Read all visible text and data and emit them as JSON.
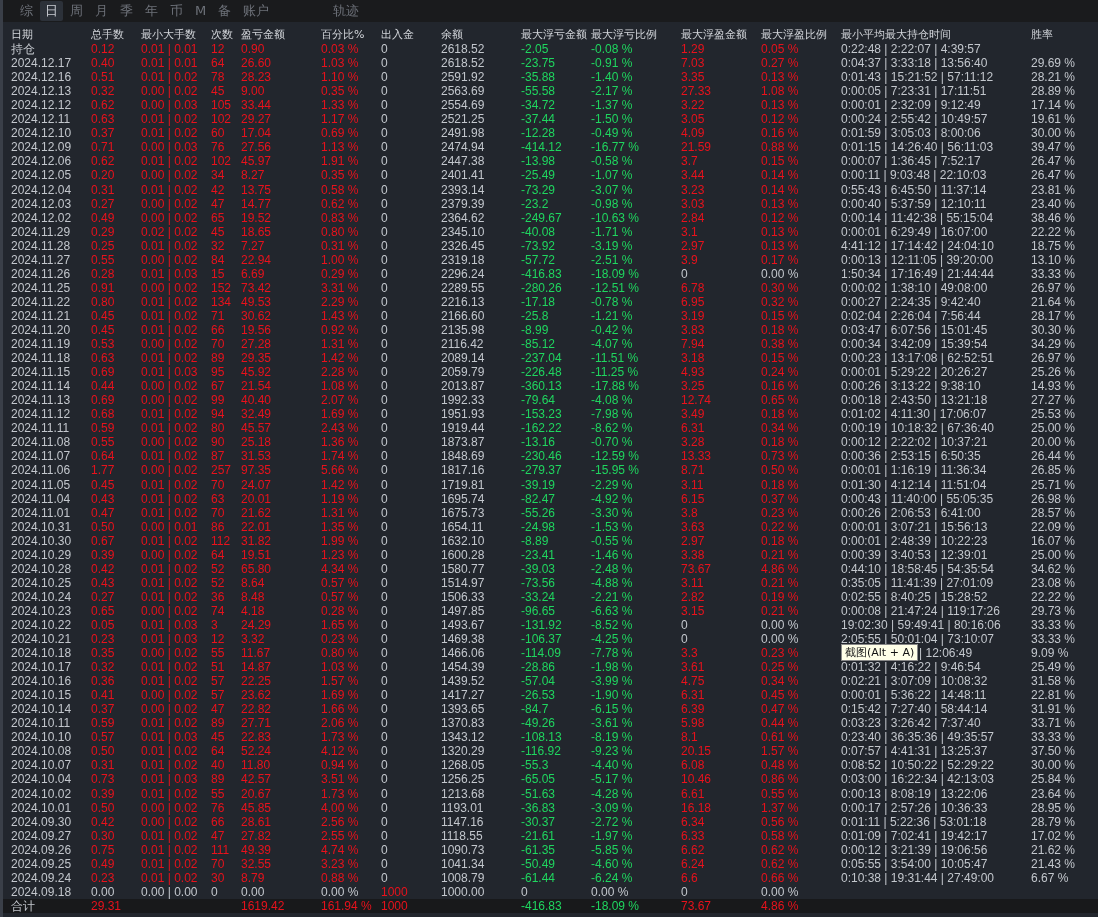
{
  "tabs": [
    {
      "label": "综",
      "selected": false
    },
    {
      "label": "日",
      "selected": true
    },
    {
      "label": "周",
      "selected": false
    },
    {
      "label": "月",
      "selected": false
    },
    {
      "label": "季",
      "selected": false
    },
    {
      "label": "年",
      "selected": false
    },
    {
      "label": "币",
      "selected": false
    },
    {
      "label": "M",
      "selected": false
    },
    {
      "label": "备",
      "selected": false
    },
    {
      "label": "账户",
      "selected": false
    }
  ],
  "trail_tab": {
    "label": "轨迹",
    "selected": false
  },
  "table": {
    "columns": [
      "日期",
      "总手数",
      "最小大手数",
      "次数",
      "盈亏金额",
      "百分比%",
      "出入金",
      "余额",
      "最大浮亏金额",
      "最大浮亏比例",
      "最大浮盈金额",
      "最大浮盈比例",
      "最小平均最大持仓时间",
      "胜率"
    ],
    "rows": [
      {
        "date": "持仓",
        "lots": "0.12",
        "min_max": "0.01 | 0.01",
        "trades": "12",
        "pnl": "0.90",
        "pct": "0.03 %",
        "deposit": "0",
        "balance": "2618.52",
        "max_loss": "-2.05",
        "max_loss_pct": "-0.08 %",
        "max_gain": "1.29",
        "max_gain_pct": "0.05 %",
        "hold_time": "0:22:48 | 2:22:07 | 4:39:57",
        "traded": true,
        "deposited": false,
        "floating_gain": true,
        "floating_loss": true
      },
      {
        "date": "2024.12.17",
        "lots": "0.40",
        "min_max": "0.01 | 0.01",
        "trades": "64",
        "pnl": "26.60",
        "pct": "1.03 %",
        "deposit": "0",
        "balance": "2618.52",
        "max_loss": "-23.75",
        "max_loss_pct": "-0.91 %",
        "max_gain": "7.03",
        "max_gain_pct": "0.27 %",
        "hold_time": "0:04:37 | 3:33:18 | 13:56:40",
        "win_rate": "29.69 %",
        "traded": true,
        "deposited": false,
        "floating_gain": true,
        "floating_loss": true
      },
      {
        "date": "2024.12.16",
        "lots": "0.51",
        "min_max": "0.01 | 0.02",
        "trades": "78",
        "pnl": "28.23",
        "pct": "1.10 %",
        "deposit": "0",
        "balance": "2591.92",
        "max_loss": "-35.88",
        "max_loss_pct": "-1.40 %",
        "max_gain": "3.35",
        "max_gain_pct": "0.13 %",
        "hold_time": "0:01:43 | 15:21:52 | 57:11:12",
        "win_rate": "28.21 %",
        "traded": true,
        "deposited": false,
        "floating_gain": true,
        "floating_loss": true
      },
      {
        "date": "2024.12.13",
        "lots": "0.32",
        "min_max": "0.00 | 0.02",
        "trades": "45",
        "pnl": "9.00",
        "pct": "0.35 %",
        "deposit": "0",
        "balance": "2563.69",
        "max_loss": "-55.58",
        "max_loss_pct": "-2.17 %",
        "max_gain": "27.33",
        "max_gain_pct": "1.08 %",
        "hold_time": "0:00:05 | 7:23:31 | 17:11:51",
        "win_rate": "28.89 %",
        "traded": true,
        "deposited": false,
        "floating_gain": true,
        "floating_loss": true
      },
      {
        "date": "2024.12.12",
        "lots": "0.62",
        "min_max": "0.00 | 0.03",
        "trades": "105",
        "pnl": "33.44",
        "pct": "1.33 %",
        "deposit": "0",
        "balance": "2554.69",
        "max_loss": "-34.72",
        "max_loss_pct": "-1.37 %",
        "max_gain": "3.22",
        "max_gain_pct": "0.13 %",
        "hold_time": "0:00:01 | 2:32:09 | 9:12:49",
        "win_rate": "17.14 %",
        "traded": true,
        "deposited": false,
        "floating_gain": true,
        "floating_loss": true
      },
      {
        "date": "2024.12.11",
        "lots": "0.63",
        "min_max": "0.01 | 0.02",
        "trades": "102",
        "pnl": "29.27",
        "pct": "1.17 %",
        "deposit": "0",
        "balance": "2521.25",
        "max_loss": "-37.44",
        "max_loss_pct": "-1.50 %",
        "max_gain": "3.05",
        "max_gain_pct": "0.12 %",
        "hold_time": "0:00:24 | 2:55:42 | 10:49:57",
        "win_rate": "19.61 %",
        "traded": true,
        "deposited": false,
        "floating_gain": true,
        "floating_loss": true
      },
      {
        "date": "2024.12.10",
        "lots": "0.37",
        "min_max": "0.01 | 0.02",
        "trades": "60",
        "pnl": "17.04",
        "pct": "0.69 %",
        "deposit": "0",
        "balance": "2491.98",
        "max_loss": "-12.28",
        "max_loss_pct": "-0.49 %",
        "max_gain": "4.09",
        "max_gain_pct": "0.16 %",
        "hold_time": "0:01:59 | 3:05:03 | 8:00:06",
        "win_rate": "30.00 %",
        "traded": true,
        "deposited": false,
        "floating_gain": true,
        "floating_loss": true
      },
      {
        "date": "2024.12.09",
        "lots": "0.71",
        "min_max": "0.00 | 0.03",
        "trades": "76",
        "pnl": "27.56",
        "pct": "1.13 %",
        "deposit": "0",
        "balance": "2474.94",
        "max_loss": "-414.12",
        "max_loss_pct": "-16.77 %",
        "max_gain": "21.59",
        "max_gain_pct": "0.88 %",
        "hold_time": "0:01:15 | 14:26:40 | 56:11:03",
        "win_rate": "39.47 %",
        "traded": true,
        "deposited": false,
        "floating_gain": true,
        "floating_loss": true
      },
      {
        "date": "2024.12.06",
        "lots": "0.62",
        "min_max": "0.01 | 0.02",
        "trades": "102",
        "pnl": "45.97",
        "pct": "1.91 %",
        "deposit": "0",
        "balance": "2447.38",
        "max_loss": "-13.98",
        "max_loss_pct": "-0.58 %",
        "max_gain": "3.7",
        "max_gain_pct": "0.15 %",
        "hold_time": "0:00:07 | 1:36:45 | 7:52:17",
        "win_rate": "26.47 %",
        "traded": true,
        "deposited": false,
        "floating_gain": true,
        "floating_loss": true
      },
      {
        "date": "2024.12.05",
        "lots": "0.20",
        "min_max": "0.00 | 0.02",
        "trades": "34",
        "pnl": "8.27",
        "pct": "0.35 %",
        "deposit": "0",
        "balance": "2401.41",
        "max_loss": "-25.49",
        "max_loss_pct": "-1.07 %",
        "max_gain": "3.44",
        "max_gain_pct": "0.14 %",
        "hold_time": "0:00:11 | 9:03:48 | 22:10:03",
        "win_rate": "26.47 %",
        "traded": true,
        "deposited": false,
        "floating_gain": true,
        "floating_loss": true
      },
      {
        "date": "2024.12.04",
        "lots": "0.31",
        "min_max": "0.01 | 0.02",
        "trades": "42",
        "pnl": "13.75",
        "pct": "0.58 %",
        "deposit": "0",
        "balance": "2393.14",
        "max_loss": "-73.29",
        "max_loss_pct": "-3.07 %",
        "max_gain": "3.23",
        "max_gain_pct": "0.14 %",
        "hold_time": "0:55:43 | 6:45:50 | 11:37:14",
        "win_rate": "23.81 %",
        "traded": true,
        "deposited": false,
        "floating_gain": true,
        "floating_loss": true
      },
      {
        "date": "2024.12.03",
        "lots": "0.27",
        "min_max": "0.00 | 0.02",
        "trades": "47",
        "pnl": "14.77",
        "pct": "0.62 %",
        "deposit": "0",
        "balance": "2379.39",
        "max_loss": "-23.2",
        "max_loss_pct": "-0.98 %",
        "max_gain": "3.03",
        "max_gain_pct": "0.13 %",
        "hold_time": "0:00:40 | 5:37:59 | 12:10:11",
        "win_rate": "23.40 %",
        "traded": true,
        "deposited": false,
        "floating_gain": true,
        "floating_loss": true
      },
      {
        "date": "2024.12.02",
        "lots": "0.49",
        "min_max": "0.00 | 0.02",
        "trades": "65",
        "pnl": "19.52",
        "pct": "0.83 %",
        "deposit": "0",
        "balance": "2364.62",
        "max_loss": "-249.67",
        "max_loss_pct": "-10.63 %",
        "max_gain": "2.84",
        "max_gain_pct": "0.12 %",
        "hold_time": "0:00:14 | 11:42:38 | 55:15:04",
        "win_rate": "38.46 %",
        "traded": true,
        "deposited": false,
        "floating_gain": true,
        "floating_loss": true
      },
      {
        "date": "2024.11.29",
        "lots": "0.29",
        "min_max": "0.02 | 0.02",
        "trades": "45",
        "pnl": "18.65",
        "pct": "0.80 %",
        "deposit": "0",
        "balance": "2345.10",
        "max_loss": "-40.08",
        "max_loss_pct": "-1.71 %",
        "max_gain": "3.1",
        "max_gain_pct": "0.13 %",
        "hold_time": "0:00:01 | 6:29:49 | 16:07:00",
        "win_rate": "22.22 %",
        "traded": true,
        "deposited": false,
        "floating_gain": true,
        "floating_loss": true
      },
      {
        "date": "2024.11.28",
        "lots": "0.25",
        "min_max": "0.01 | 0.02",
        "trades": "32",
        "pnl": "7.27",
        "pct": "0.31 %",
        "deposit": "0",
        "balance": "2326.45",
        "max_loss": "-73.92",
        "max_loss_pct": "-3.19 %",
        "max_gain": "2.97",
        "max_gain_pct": "0.13 %",
        "hold_time": "4:41:12 | 17:14:42 | 24:04:10",
        "win_rate": "18.75 %",
        "traded": true,
        "deposited": false,
        "floating_gain": true,
        "floating_loss": true
      },
      {
        "date": "2024.11.27",
        "lots": "0.55",
        "min_max": "0.00 | 0.02",
        "trades": "84",
        "pnl": "22.94",
        "pct": "1.00 %",
        "deposit": "0",
        "balance": "2319.18",
        "max_loss": "-57.72",
        "max_loss_pct": "-2.51 %",
        "max_gain": "3.9",
        "max_gain_pct": "0.17 %",
        "hold_time": "0:00:13 | 12:11:05 | 39:20:00",
        "win_rate": "13.10 %",
        "traded": true,
        "deposited": false,
        "floating_gain": true,
        "floating_loss": true
      },
      {
        "date": "2024.11.26",
        "lots": "0.28",
        "min_max": "0.01 | 0.03",
        "trades": "15",
        "pnl": "6.69",
        "pct": "0.29 %",
        "deposit": "0",
        "balance": "2296.24",
        "max_loss": "-416.83",
        "max_loss_pct": "-18.09 %",
        "max_gain": "0",
        "max_gain_pct": "0.00 %",
        "hold_time": "1:50:34 | 17:16:49 | 21:44:44",
        "win_rate": "33.33 %",
        "traded": true,
        "deposited": false,
        "floating_gain": false,
        "floating_loss": true
      },
      {
        "date": "2024.11.25",
        "lots": "0.91",
        "min_max": "0.00 | 0.02",
        "trades": "152",
        "pnl": "73.42",
        "pct": "3.31 %",
        "deposit": "0",
        "balance": "2289.55",
        "max_loss": "-280.26",
        "max_loss_pct": "-12.51 %",
        "max_gain": "6.78",
        "max_gain_pct": "0.30 %",
        "hold_time": "0:00:02 | 1:38:10 | 49:08:00",
        "win_rate": "26.97 %",
        "traded": true,
        "deposited": false,
        "floating_gain": true,
        "floating_loss": true
      },
      {
        "date": "2024.11.22",
        "lots": "0.80",
        "min_max": "0.01 | 0.02",
        "trades": "134",
        "pnl": "49.53",
        "pct": "2.29 %",
        "deposit": "0",
        "balance": "2216.13",
        "max_loss": "-17.18",
        "max_loss_pct": "-0.78 %",
        "max_gain": "6.95",
        "max_gain_pct": "0.32 %",
        "hold_time": "0:00:27 | 2:24:35 | 9:42:40",
        "win_rate": "21.64 %",
        "traded": true,
        "deposited": false,
        "floating_gain": true,
        "floating_loss": true
      },
      {
        "date": "2024.11.21",
        "lots": "0.45",
        "min_max": "0.01 | 0.02",
        "trades": "71",
        "pnl": "30.62",
        "pct": "1.43 %",
        "deposit": "0",
        "balance": "2166.60",
        "max_loss": "-25.8",
        "max_loss_pct": "-1.21 %",
        "max_gain": "3.19",
        "max_gain_pct": "0.15 %",
        "hold_time": "0:02:04 | 2:26:04 | 7:56:44",
        "win_rate": "28.17 %",
        "traded": true,
        "deposited": false,
        "floating_gain": true,
        "floating_loss": true
      },
      {
        "date": "2024.11.20",
        "lots": "0.45",
        "min_max": "0.01 | 0.02",
        "trades": "66",
        "pnl": "19.56",
        "pct": "0.92 %",
        "deposit": "0",
        "balance": "2135.98",
        "max_loss": "-8.99",
        "max_loss_pct": "-0.42 %",
        "max_gain": "3.83",
        "max_gain_pct": "0.18 %",
        "hold_time": "0:03:47 | 6:07:56 | 15:01:45",
        "win_rate": "30.30 %",
        "traded": true,
        "deposited": false,
        "floating_gain": true,
        "floating_loss": true
      },
      {
        "date": "2024.11.19",
        "lots": "0.53",
        "min_max": "0.00 | 0.02",
        "trades": "70",
        "pnl": "27.28",
        "pct": "1.31 %",
        "deposit": "0",
        "balance": "2116.42",
        "max_loss": "-85.12",
        "max_loss_pct": "-4.07 %",
        "max_gain": "7.94",
        "max_gain_pct": "0.38 %",
        "hold_time": "0:00:34 | 3:42:09 | 15:39:54",
        "win_rate": "34.29 %",
        "traded": true,
        "deposited": false,
        "floating_gain": true,
        "floating_loss": true
      },
      {
        "date": "2024.11.18",
        "lots": "0.63",
        "min_max": "0.01 | 0.02",
        "trades": "89",
        "pnl": "29.35",
        "pct": "1.42 %",
        "deposit": "0",
        "balance": "2089.14",
        "max_loss": "-237.04",
        "max_loss_pct": "-11.51 %",
        "max_gain": "3.18",
        "max_gain_pct": "0.15 %",
        "hold_time": "0:00:23 | 13:17:08 | 62:52:51",
        "win_rate": "26.97 %",
        "traded": true,
        "deposited": false,
        "floating_gain": true,
        "floating_loss": true
      },
      {
        "date": "2024.11.15",
        "lots": "0.69",
        "min_max": "0.01 | 0.03",
        "trades": "95",
        "pnl": "45.92",
        "pct": "2.28 %",
        "deposit": "0",
        "balance": "2059.79",
        "max_loss": "-226.48",
        "max_loss_pct": "-11.25 %",
        "max_gain": "4.93",
        "max_gain_pct": "0.24 %",
        "hold_time": "0:00:01 | 5:29:22 | 20:26:27",
        "win_rate": "25.26 %",
        "traded": true,
        "deposited": false,
        "floating_gain": true,
        "floating_loss": true
      },
      {
        "date": "2024.11.14",
        "lots": "0.44",
        "min_max": "0.00 | 0.02",
        "trades": "67",
        "pnl": "21.54",
        "pct": "1.08 %",
        "deposit": "0",
        "balance": "2013.87",
        "max_loss": "-360.13",
        "max_loss_pct": "-17.88 %",
        "max_gain": "3.25",
        "max_gain_pct": "0.16 %",
        "hold_time": "0:00:26 | 3:13:22 | 9:38:10",
        "win_rate": "14.93 %",
        "traded": true,
        "deposited": false,
        "floating_gain": true,
        "floating_loss": true
      },
      {
        "date": "2024.11.13",
        "lots": "0.69",
        "min_max": "0.00 | 0.02",
        "trades": "99",
        "pnl": "40.40",
        "pct": "2.07 %",
        "deposit": "0",
        "balance": "1992.33",
        "max_loss": "-79.64",
        "max_loss_pct": "-4.08 %",
        "max_gain": "12.74",
        "max_gain_pct": "0.65 %",
        "hold_time": "0:00:18 | 2:43:50 | 13:21:18",
        "win_rate": "27.27 %",
        "traded": true,
        "deposited": false,
        "floating_gain": true,
        "floating_loss": true
      },
      {
        "date": "2024.11.12",
        "lots": "0.68",
        "min_max": "0.01 | 0.02",
        "trades": "94",
        "pnl": "32.49",
        "pct": "1.69 %",
        "deposit": "0",
        "balance": "1951.93",
        "max_loss": "-153.23",
        "max_loss_pct": "-7.98 %",
        "max_gain": "3.49",
        "max_gain_pct": "0.18 %",
        "hold_time": "0:01:02 | 4:11:30 | 17:06:07",
        "win_rate": "25.53 %",
        "traded": true,
        "deposited": false,
        "floating_gain": true,
        "floating_loss": true
      },
      {
        "date": "2024.11.11",
        "lots": "0.59",
        "min_max": "0.01 | 0.02",
        "trades": "80",
        "pnl": "45.57",
        "pct": "2.43 %",
        "deposit": "0",
        "balance": "1919.44",
        "max_loss": "-162.22",
        "max_loss_pct": "-8.62 %",
        "max_gain": "6.31",
        "max_gain_pct": "0.34 %",
        "hold_time": "0:00:19 | 10:18:32 | 67:36:40",
        "win_rate": "25.00 %",
        "traded": true,
        "deposited": false,
        "floating_gain": true,
        "floating_loss": true
      },
      {
        "date": "2024.11.08",
        "lots": "0.55",
        "min_max": "0.00 | 0.02",
        "trades": "90",
        "pnl": "25.18",
        "pct": "1.36 %",
        "deposit": "0",
        "balance": "1873.87",
        "max_loss": "-13.16",
        "max_loss_pct": "-0.70 %",
        "max_gain": "3.28",
        "max_gain_pct": "0.18 %",
        "hold_time": "0:00:12 | 2:22:02 | 10:37:21",
        "win_rate": "20.00 %",
        "traded": true,
        "deposited": false,
        "floating_gain": true,
        "floating_loss": true
      },
      {
        "date": "2024.11.07",
        "lots": "0.64",
        "min_max": "0.01 | 0.02",
        "trades": "87",
        "pnl": "31.53",
        "pct": "1.74 %",
        "deposit": "0",
        "balance": "1848.69",
        "max_loss": "-230.46",
        "max_loss_pct": "-12.59 %",
        "max_gain": "13.33",
        "max_gain_pct": "0.73 %",
        "hold_time": "0:00:36 | 2:53:15 | 6:50:35",
        "win_rate": "26.44 %",
        "traded": true,
        "deposited": false,
        "floating_gain": true,
        "floating_loss": true
      },
      {
        "date": "2024.11.06",
        "lots": "1.77",
        "min_max": "0.00 | 0.02",
        "trades": "257",
        "pnl": "97.35",
        "pct": "5.66 %",
        "deposit": "0",
        "balance": "1817.16",
        "max_loss": "-279.37",
        "max_loss_pct": "-15.95 %",
        "max_gain": "8.71",
        "max_gain_pct": "0.50 %",
        "hold_time": "0:00:01 | 1:16:19 | 11:36:34",
        "win_rate": "26.85 %",
        "traded": true,
        "deposited": false,
        "floating_gain": true,
        "floating_loss": true
      },
      {
        "date": "2024.11.05",
        "lots": "0.45",
        "min_max": "0.01 | 0.02",
        "trades": "70",
        "pnl": "24.07",
        "pct": "1.42 %",
        "deposit": "0",
        "balance": "1719.81",
        "max_loss": "-39.19",
        "max_loss_pct": "-2.29 %",
        "max_gain": "3.11",
        "max_gain_pct": "0.18 %",
        "hold_time": "0:01:30 | 4:12:14 | 11:51:04",
        "win_rate": "25.71 %",
        "traded": true,
        "deposited": false,
        "floating_gain": true,
        "floating_loss": true
      },
      {
        "date": "2024.11.04",
        "lots": "0.43",
        "min_max": "0.01 | 0.02",
        "trades": "63",
        "pnl": "20.01",
        "pct": "1.19 %",
        "deposit": "0",
        "balance": "1695.74",
        "max_loss": "-82.47",
        "max_loss_pct": "-4.92 %",
        "max_gain": "6.15",
        "max_gain_pct": "0.37 %",
        "hold_time": "0:00:43 | 11:40:00 | 55:05:35",
        "win_rate": "26.98 %",
        "traded": true,
        "deposited": false,
        "floating_gain": true,
        "floating_loss": true
      },
      {
        "date": "2024.11.01",
        "lots": "0.47",
        "min_max": "0.01 | 0.02",
        "trades": "70",
        "pnl": "21.62",
        "pct": "1.31 %",
        "deposit": "0",
        "balance": "1675.73",
        "max_loss": "-55.26",
        "max_loss_pct": "-3.30 %",
        "max_gain": "3.8",
        "max_gain_pct": "0.23 %",
        "hold_time": "0:00:26 | 2:06:53 | 6:41:00",
        "win_rate": "28.57 %",
        "traded": true,
        "deposited": false,
        "floating_gain": true,
        "floating_loss": true
      },
      {
        "date": "2024.10.31",
        "lots": "0.50",
        "min_max": "0.00 | 0.01",
        "trades": "86",
        "pnl": "22.01",
        "pct": "1.35 %",
        "deposit": "0",
        "balance": "1654.11",
        "max_loss": "-24.98",
        "max_loss_pct": "-1.53 %",
        "max_gain": "3.63",
        "max_gain_pct": "0.22 %",
        "hold_time": "0:00:01 | 3:07:21 | 15:56:13",
        "win_rate": "22.09 %",
        "traded": true,
        "deposited": false,
        "floating_gain": true,
        "floating_loss": true
      },
      {
        "date": "2024.10.30",
        "lots": "0.67",
        "min_max": "0.01 | 0.02",
        "trades": "112",
        "pnl": "31.82",
        "pct": "1.99 %",
        "deposit": "0",
        "balance": "1632.10",
        "max_loss": "-8.89",
        "max_loss_pct": "-0.55 %",
        "max_gain": "2.97",
        "max_gain_pct": "0.18 %",
        "hold_time": "0:00:01 | 2:48:39 | 10:22:23",
        "win_rate": "16.07 %",
        "traded": true,
        "deposited": false,
        "floating_gain": true,
        "floating_loss": true
      },
      {
        "date": "2024.10.29",
        "lots": "0.39",
        "min_max": "0.00 | 0.02",
        "trades": "64",
        "pnl": "19.51",
        "pct": "1.23 %",
        "deposit": "0",
        "balance": "1600.28",
        "max_loss": "-23.41",
        "max_loss_pct": "-1.46 %",
        "max_gain": "3.38",
        "max_gain_pct": "0.21 %",
        "hold_time": "0:00:39 | 3:40:53 | 12:39:01",
        "win_rate": "25.00 %",
        "traded": true,
        "deposited": false,
        "floating_gain": true,
        "floating_loss": true
      },
      {
        "date": "2024.10.28",
        "lots": "0.42",
        "min_max": "0.01 | 0.02",
        "trades": "52",
        "pnl": "65.80",
        "pct": "4.34 %",
        "deposit": "0",
        "balance": "1580.77",
        "max_loss": "-39.03",
        "max_loss_pct": "-2.48 %",
        "max_gain": "73.67",
        "max_gain_pct": "4.86 %",
        "hold_time": "0:44:10 | 18:58:45 | 54:35:54",
        "win_rate": "34.62 %",
        "traded": true,
        "deposited": false,
        "floating_gain": true,
        "floating_loss": true
      },
      {
        "date": "2024.10.25",
        "lots": "0.43",
        "min_max": "0.01 | 0.02",
        "trades": "52",
        "pnl": "8.64",
        "pct": "0.57 %",
        "deposit": "0",
        "balance": "1514.97",
        "max_loss": "-73.56",
        "max_loss_pct": "-4.88 %",
        "max_gain": "3.11",
        "max_gain_pct": "0.21 %",
        "hold_time": "0:35:05 | 11:41:39 | 27:01:09",
        "win_rate": "23.08 %",
        "traded": true,
        "deposited": false,
        "floating_gain": true,
        "floating_loss": true
      },
      {
        "date": "2024.10.24",
        "lots": "0.27",
        "min_max": "0.01 | 0.02",
        "trades": "36",
        "pnl": "8.48",
        "pct": "0.57 %",
        "deposit": "0",
        "balance": "1506.33",
        "max_loss": "-33.24",
        "max_loss_pct": "-2.21 %",
        "max_gain": "2.82",
        "max_gain_pct": "0.19 %",
        "hold_time": "0:02:55 | 8:40:25 | 15:28:52",
        "win_rate": "22.22 %",
        "traded": true,
        "deposited": false,
        "floating_gain": true,
        "floating_loss": true
      },
      {
        "date": "2024.10.23",
        "lots": "0.65",
        "min_max": "0.00 | 0.02",
        "trades": "74",
        "pnl": "4.18",
        "pct": "0.28 %",
        "deposit": "0",
        "balance": "1497.85",
        "max_loss": "-96.65",
        "max_loss_pct": "-6.63 %",
        "max_gain": "3.15",
        "max_gain_pct": "0.21 %",
        "hold_time": "0:00:08 | 21:47:24 | 119:17:26",
        "win_rate": "29.73 %",
        "traded": true,
        "deposited": false,
        "floating_gain": true,
        "floating_loss": true
      },
      {
        "date": "2024.10.22",
        "lots": "0.05",
        "min_max": "0.01 | 0.03",
        "trades": "3",
        "pnl": "24.29",
        "pct": "1.65 %",
        "deposit": "0",
        "balance": "1493.67",
        "max_loss": "-131.92",
        "max_loss_pct": "-8.52 %",
        "max_gain": "0",
        "max_gain_pct": "0.00 %",
        "hold_time": "19:02:30 | 59:49:41 | 80:16:06",
        "win_rate": "33.33 %",
        "traded": true,
        "deposited": false,
        "floating_gain": false,
        "floating_loss": true
      },
      {
        "date": "2024.10.21",
        "lots": "0.23",
        "min_max": "0.01 | 0.03",
        "trades": "12",
        "pnl": "3.32",
        "pct": "0.23 %",
        "deposit": "0",
        "balance": "1469.38",
        "max_loss": "-106.37",
        "max_loss_pct": "-4.25 %",
        "max_gain": "0",
        "max_gain_pct": "0.00 %",
        "hold_time": "2:05:55 | 50:01:04 | 73:10:07",
        "win_rate": "33.33 %",
        "traded": true,
        "deposited": false,
        "floating_gain": false,
        "floating_loss": true
      },
      {
        "date": "2024.10.18",
        "lots": "0.35",
        "min_max": "0.00 | 0.02",
        "trades": "55",
        "pnl": "11.67",
        "pct": "0.80 %",
        "deposit": "0",
        "balance": "1466.06",
        "max_loss": "-114.09",
        "max_loss_pct": "-7.78 %",
        "max_gain": "3.3",
        "max_gain_pct": "0.23 %",
        "tooltip": "截图(Alt + A)",
        "hold_time": "| 12:06:49",
        "win_rate": "9.09 %",
        "traded": true,
        "deposited": false,
        "floating_gain": true,
        "floating_loss": true
      },
      {
        "date": "2024.10.17",
        "lots": "0.32",
        "min_max": "0.01 | 0.02",
        "trades": "51",
        "pnl": "14.87",
        "pct": "1.03 %",
        "deposit": "0",
        "balance": "1454.39",
        "max_loss": "-28.86",
        "max_loss_pct": "-1.98 %",
        "max_gain": "3.61",
        "max_gain_pct": "0.25 %",
        "hold_time": "0:01:32 | 4:16:22 | 9:46:54",
        "win_rate": "25.49 %",
        "traded": true,
        "deposited": false,
        "floating_gain": true,
        "floating_loss": true
      },
      {
        "date": "2024.10.16",
        "lots": "0.36",
        "min_max": "0.01 | 0.02",
        "trades": "57",
        "pnl": "22.25",
        "pct": "1.57 %",
        "deposit": "0",
        "balance": "1439.52",
        "max_loss": "-57.04",
        "max_loss_pct": "-3.99 %",
        "max_gain": "4.75",
        "max_gain_pct": "0.34 %",
        "hold_time": "0:02:21 | 3:07:09 | 10:08:32",
        "win_rate": "31.58 %",
        "traded": true,
        "deposited": false,
        "floating_gain": true,
        "floating_loss": true
      },
      {
        "date": "2024.10.15",
        "lots": "0.41",
        "min_max": "0.00 | 0.02",
        "trades": "57",
        "pnl": "23.62",
        "pct": "1.69 %",
        "deposit": "0",
        "balance": "1417.27",
        "max_loss": "-26.53",
        "max_loss_pct": "-1.90 %",
        "max_gain": "6.31",
        "max_gain_pct": "0.45 %",
        "hold_time": "0:00:01 | 5:36:22 | 14:48:11",
        "win_rate": "22.81 %",
        "traded": true,
        "deposited": false,
        "floating_gain": true,
        "floating_loss": true
      },
      {
        "date": "2024.10.14",
        "lots": "0.37",
        "min_max": "0.00 | 0.02",
        "trades": "47",
        "pnl": "22.82",
        "pct": "1.66 %",
        "deposit": "0",
        "balance": "1393.65",
        "max_loss": "-84.7",
        "max_loss_pct": "-6.15 %",
        "max_gain": "6.39",
        "max_gain_pct": "0.47 %",
        "hold_time": "0:15:42 | 7:27:40 | 58:44:14",
        "win_rate": "31.91 %",
        "traded": true,
        "deposited": false,
        "floating_gain": true,
        "floating_loss": true
      },
      {
        "date": "2024.10.11",
        "lots": "0.59",
        "min_max": "0.01 | 0.02",
        "trades": "89",
        "pnl": "27.71",
        "pct": "2.06 %",
        "deposit": "0",
        "balance": "1370.83",
        "max_loss": "-49.26",
        "max_loss_pct": "-3.61 %",
        "max_gain": "5.98",
        "max_gain_pct": "0.44 %",
        "hold_time": "0:03:23 | 3:26:42 | 7:37:40",
        "win_rate": "33.71 %",
        "traded": true,
        "deposited": false,
        "floating_gain": true,
        "floating_loss": true
      },
      {
        "date": "2024.10.10",
        "lots": "0.57",
        "min_max": "0.01 | 0.03",
        "trades": "45",
        "pnl": "22.83",
        "pct": "1.73 %",
        "deposit": "0",
        "balance": "1343.12",
        "max_loss": "-108.13",
        "max_loss_pct": "-8.19 %",
        "max_gain": "8.1",
        "max_gain_pct": "0.61 %",
        "hold_time": "0:23:40 | 36:35:36 | 49:35:57",
        "win_rate": "33.33 %",
        "traded": true,
        "deposited": false,
        "floating_gain": true,
        "floating_loss": true
      },
      {
        "date": "2024.10.08",
        "lots": "0.50",
        "min_max": "0.01 | 0.02",
        "trades": "64",
        "pnl": "52.24",
        "pct": "4.12 %",
        "deposit": "0",
        "balance": "1320.29",
        "max_loss": "-116.92",
        "max_loss_pct": "-9.23 %",
        "max_gain": "20.15",
        "max_gain_pct": "1.57 %",
        "hold_time": "0:07:57 | 4:41:31 | 13:25:37",
        "win_rate": "37.50 %",
        "traded": true,
        "deposited": false,
        "floating_gain": true,
        "floating_loss": true
      },
      {
        "date": "2024.10.07",
        "lots": "0.31",
        "min_max": "0.01 | 0.02",
        "trades": "40",
        "pnl": "11.80",
        "pct": "0.94 %",
        "deposit": "0",
        "balance": "1268.05",
        "max_loss": "-55.3",
        "max_loss_pct": "-4.40 %",
        "max_gain": "6.08",
        "max_gain_pct": "0.48 %",
        "hold_time": "0:08:52 | 10:50:22 | 52:29:22",
        "win_rate": "30.00 %",
        "traded": true,
        "deposited": false,
        "floating_gain": true,
        "floating_loss": true
      },
      {
        "date": "2024.10.04",
        "lots": "0.73",
        "min_max": "0.01 | 0.03",
        "trades": "89",
        "pnl": "42.57",
        "pct": "3.51 %",
        "deposit": "0",
        "balance": "1256.25",
        "max_loss": "-65.05",
        "max_loss_pct": "-5.17 %",
        "max_gain": "10.46",
        "max_gain_pct": "0.86 %",
        "hold_time": "0:03:00 | 16:22:34 | 42:13:03",
        "win_rate": "25.84 %",
        "traded": true,
        "deposited": false,
        "floating_gain": true,
        "floating_loss": true
      },
      {
        "date": "2024.10.02",
        "lots": "0.39",
        "min_max": "0.01 | 0.02",
        "trades": "55",
        "pnl": "20.67",
        "pct": "1.73 %",
        "deposit": "0",
        "balance": "1213.68",
        "max_loss": "-51.63",
        "max_loss_pct": "-4.28 %",
        "max_gain": "6.61",
        "max_gain_pct": "0.55 %",
        "hold_time": "0:00:13 | 8:08:19 | 13:22:06",
        "win_rate": "23.64 %",
        "traded": true,
        "deposited": false,
        "floating_gain": true,
        "floating_loss": true
      },
      {
        "date": "2024.10.01",
        "lots": "0.50",
        "min_max": "0.00 | 0.02",
        "trades": "76",
        "pnl": "45.85",
        "pct": "4.00 %",
        "deposit": "0",
        "balance": "1193.01",
        "max_loss": "-36.83",
        "max_loss_pct": "-3.09 %",
        "max_gain": "16.18",
        "max_gain_pct": "1.37 %",
        "hold_time": "0:00:17 | 2:57:26 | 10:36:33",
        "win_rate": "28.95 %",
        "traded": true,
        "deposited": false,
        "floating_gain": true,
        "floating_loss": true
      },
      {
        "date": "2024.09.30",
        "lots": "0.42",
        "min_max": "0.00 | 0.02",
        "trades": "66",
        "pnl": "28.61",
        "pct": "2.56 %",
        "deposit": "0",
        "balance": "1147.16",
        "max_loss": "-30.37",
        "max_loss_pct": "-2.72 %",
        "max_gain": "6.34",
        "max_gain_pct": "0.56 %",
        "hold_time": "0:01:11 | 5:22:36 | 53:01:18",
        "win_rate": "28.79 %",
        "traded": true,
        "deposited": false,
        "floating_gain": true,
        "floating_loss": true
      },
      {
        "date": "2024.09.27",
        "lots": "0.30",
        "min_max": "0.01 | 0.02",
        "trades": "47",
        "pnl": "27.82",
        "pct": "2.55 %",
        "deposit": "0",
        "balance": "1118.55",
        "max_loss": "-21.61",
        "max_loss_pct": "-1.97 %",
        "max_gain": "6.33",
        "max_gain_pct": "0.58 %",
        "hold_time": "0:01:09 | 7:02:41 | 19:42:17",
        "win_rate": "17.02 %",
        "traded": true,
        "deposited": false,
        "floating_gain": true,
        "floating_loss": true
      },
      {
        "date": "2024.09.26",
        "lots": "0.75",
        "min_max": "0.01 | 0.02",
        "trades": "111",
        "pnl": "49.39",
        "pct": "4.74 %",
        "deposit": "0",
        "balance": "1090.73",
        "max_loss": "-61.35",
        "max_loss_pct": "-5.85 %",
        "max_gain": "6.62",
        "max_gain_pct": "0.62 %",
        "hold_time": "0:00:12 | 3:21:39 | 19:06:56",
        "win_rate": "21.62 %",
        "traded": true,
        "deposited": false,
        "floating_gain": true,
        "floating_loss": true
      },
      {
        "date": "2024.09.25",
        "lots": "0.49",
        "min_max": "0.01 | 0.02",
        "trades": "70",
        "pnl": "32.55",
        "pct": "3.23 %",
        "deposit": "0",
        "balance": "1041.34",
        "max_loss": "-50.49",
        "max_loss_pct": "-4.60 %",
        "max_gain": "6.24",
        "max_gain_pct": "0.62 %",
        "hold_time": "0:05:55 | 3:54:00 | 10:05:47",
        "win_rate": "21.43 %",
        "traded": true,
        "deposited": false,
        "floating_gain": true,
        "floating_loss": true
      },
      {
        "date": "2024.09.24",
        "lots": "0.23",
        "min_max": "0.01 | 0.02",
        "trades": "30",
        "pnl": "8.79",
        "pct": "0.88 %",
        "deposit": "0",
        "balance": "1008.79",
        "max_loss": "-61.44",
        "max_loss_pct": "-6.24 %",
        "max_gain": "6.6",
        "max_gain_pct": "0.66 %",
        "hold_time": "0:10:38 | 19:31:44 | 27:49:00",
        "win_rate": "6.67 %",
        "traded": true,
        "deposited": false,
        "floating_gain": true,
        "floating_loss": true
      },
      {
        "date": "2024.09.18",
        "lots": "0.00",
        "min_max": "0.00 | 0.00",
        "trades": "0",
        "pnl": "0.00",
        "pct": "0.00 %",
        "deposit": "1000",
        "balance": "1000.00",
        "max_loss": "0",
        "max_loss_pct": "0.00 %",
        "max_gain": "0",
        "max_gain_pct": "0.00 %",
        "traded": false,
        "deposited": true,
        "floating_gain": false,
        "floating_loss": false
      }
    ],
    "totals": {
      "label": "合计",
      "lots": "29.31",
      "pnl": "1619.42",
      "pct": "161.94 %",
      "deposit": "1000",
      "max_loss": "-416.83",
      "max_loss_pct": "-18.09 %",
      "max_gain": "73.67",
      "max_gain_pct": "4.86 %",
      "deposited": true
    }
  }
}
